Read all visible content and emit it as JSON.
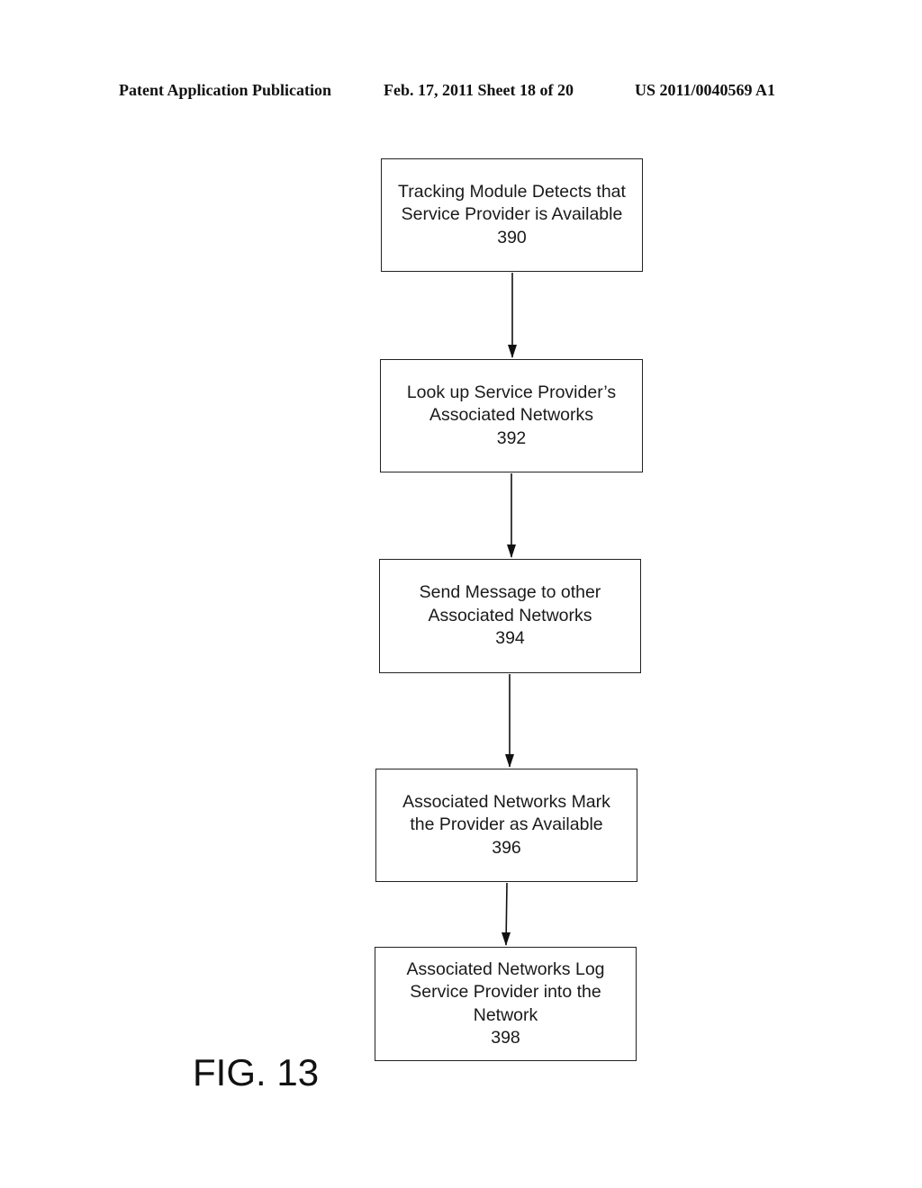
{
  "header": {
    "left": "Patent Application Publication",
    "middle": "Feb. 17, 2011   Sheet 18 of 20",
    "right": "US 2011/0040569 A1"
  },
  "flowchart": {
    "steps": [
      {
        "lines": [
          "Tracking Module Detects that",
          "Service Provider is Available"
        ],
        "ref": "390"
      },
      {
        "lines": [
          "Look up Service Provider’s",
          "Associated Networks"
        ],
        "ref": "392"
      },
      {
        "lines": [
          "Send Message to other",
          "Associated Networks"
        ],
        "ref": "394"
      },
      {
        "lines": [
          "Associated Networks Mark",
          "the Provider as Available"
        ],
        "ref": "396"
      },
      {
        "lines": [
          "Associated Networks Log",
          "Service Provider into the",
          "Network"
        ],
        "ref": "398"
      }
    ],
    "connections": [
      {
        "from": "390",
        "to": "392"
      },
      {
        "from": "392",
        "to": "394"
      },
      {
        "from": "394",
        "to": "396"
      },
      {
        "from": "396",
        "to": "398"
      }
    ]
  },
  "figure_label": "FIG. 13"
}
